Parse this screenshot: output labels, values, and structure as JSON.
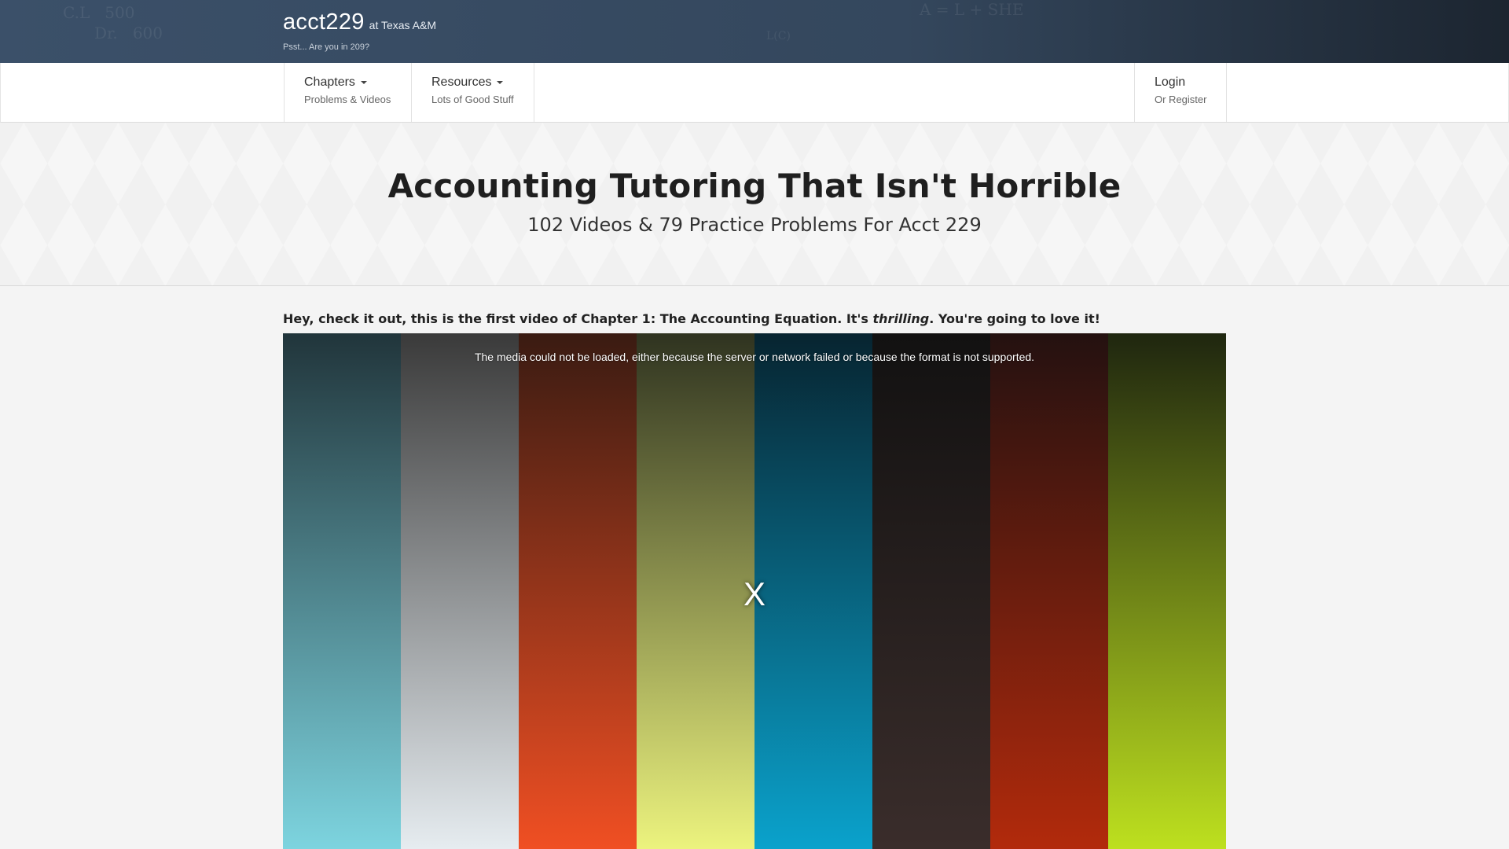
{
  "header": {
    "brand_name": "acct229",
    "brand_sub": "at Texas A&M",
    "tagline": "Psst... Are you in 209?"
  },
  "nav": {
    "chapters": {
      "title": "Chapters",
      "sub": "Problems & Videos"
    },
    "resources": {
      "title": "Resources",
      "sub": "Lots of Good Stuff"
    },
    "login": {
      "title": "Login",
      "sub": "Or Register"
    }
  },
  "hero": {
    "title": "Accounting Tutoring That Isn't Horrible",
    "subtitle": "102 Videos & 79 Practice Problems For Acct 229"
  },
  "intro": {
    "before": "Hey, check it out, this is the first video of Chapter 1: The Accounting Equation. It's ",
    "emphasis": "thrilling",
    "after": ". You're going to love it!"
  },
  "video": {
    "error_message": "The media could not be loaded, either because the server or network failed or because the format is not supported.",
    "close_glyph": "X",
    "bar_colors": [
      [
        "#21353b",
        "#7dd4df"
      ],
      [
        "#3a3a3a",
        "#e6ecf0"
      ],
      [
        "#3a1b12",
        "#f04f23"
      ],
      [
        "#2f3320",
        "#ecf37e"
      ],
      [
        "#072430",
        "#0aa2cc"
      ],
      [
        "#121111",
        "#3a2d2b"
      ],
      [
        "#241110",
        "#b22a0c"
      ],
      [
        "#1f260f",
        "#bde01f"
      ]
    ]
  }
}
